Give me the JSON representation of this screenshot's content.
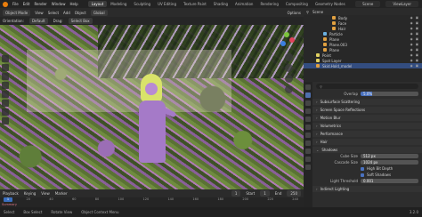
{
  "topbar": {
    "menus": [
      "File",
      "Edit",
      "Render",
      "Window",
      "Help"
    ],
    "workspaces": [
      "Layout",
      "Modeling",
      "Sculpting",
      "UV Editing",
      "Texture Paint",
      "Shading",
      "Animation",
      "Rendering",
      "Compositing",
      "Geometry Nodes"
    ],
    "active_workspace": "Layout",
    "scene": "Scene",
    "view_layer": "ViewLayer"
  },
  "viewport_header": {
    "mode": "Object Mode",
    "menus": [
      "View",
      "Select",
      "Add",
      "Object"
    ],
    "transform": "Global",
    "options": "Options"
  },
  "tool_header": {
    "orientation_label": "Orientation:",
    "orientation_value": "Default",
    "drag_label": "Drag:",
    "drag_value": "Select Box"
  },
  "outliner": {
    "rows": [
      {
        "label": "Body",
        "indent": 32,
        "color": "#e0a040",
        "selected": false
      },
      {
        "label": "Face",
        "indent": 32,
        "color": "#e0a040",
        "selected": false
      },
      {
        "label": "Hair",
        "indent": 32,
        "color": "#e0a040",
        "selected": false
      },
      {
        "label": "Particle",
        "indent": 22,
        "color": "#6ab0e0",
        "selected": false
      },
      {
        "label": "Plane",
        "indent": 22,
        "color": "#e0a040",
        "selected": false
      },
      {
        "label": "Plane.003",
        "indent": 22,
        "color": "#e0a040",
        "selected": false
      },
      {
        "label": "Plane",
        "indent": 22,
        "color": "#e0a040",
        "selected": false
      },
      {
        "label": "Point",
        "indent": 14,
        "color": "#e0d060",
        "selected": false
      },
      {
        "label": "Spot Layer",
        "indent": 14,
        "color": "#e0d060",
        "selected": false
      },
      {
        "label": "Skid.Hold_model",
        "indent": 14,
        "color": "#e0a040",
        "selected": true
      }
    ]
  },
  "properties": {
    "search_placeholder": "",
    "overlap_label": "Overlap",
    "overlap_value": "5.0%",
    "sections": [
      "Subsurface Scattering",
      "Screen Space Reflections",
      "Motion Blur",
      "Volumetrics",
      "Performance",
      "Hair",
      "Shadows"
    ],
    "cube_size_label": "Cube Size",
    "cube_size_value": "512 px",
    "cascade_size_label": "Cascade Size",
    "cascade_size_value": "1024 px",
    "high_bit_depth": "High Bit Depth",
    "soft_shadows": "Soft Shadows",
    "light_threshold_label": "Light Threshold",
    "light_threshold_value": "0.001",
    "indirect_lighting": "Indirect Lighting",
    "overlap_fraction": 0.2
  },
  "timeline": {
    "menus": [
      "Playback",
      "Keying",
      "View",
      "Marker"
    ],
    "current_frame": "1",
    "start_label": "Start",
    "start_value": "1",
    "end_label": "End",
    "end_value": "250",
    "ticks": [
      "0",
      "20",
      "40",
      "60",
      "80",
      "100",
      "120",
      "140",
      "160",
      "180",
      "200",
      "220",
      "240"
    ],
    "summary": "Summary"
  },
  "statusbar": {
    "select": "Select",
    "box_select": "Box Select",
    "rotate": "Rotate View",
    "context_menu": "Object Context Menu",
    "version": "3.2.0"
  }
}
